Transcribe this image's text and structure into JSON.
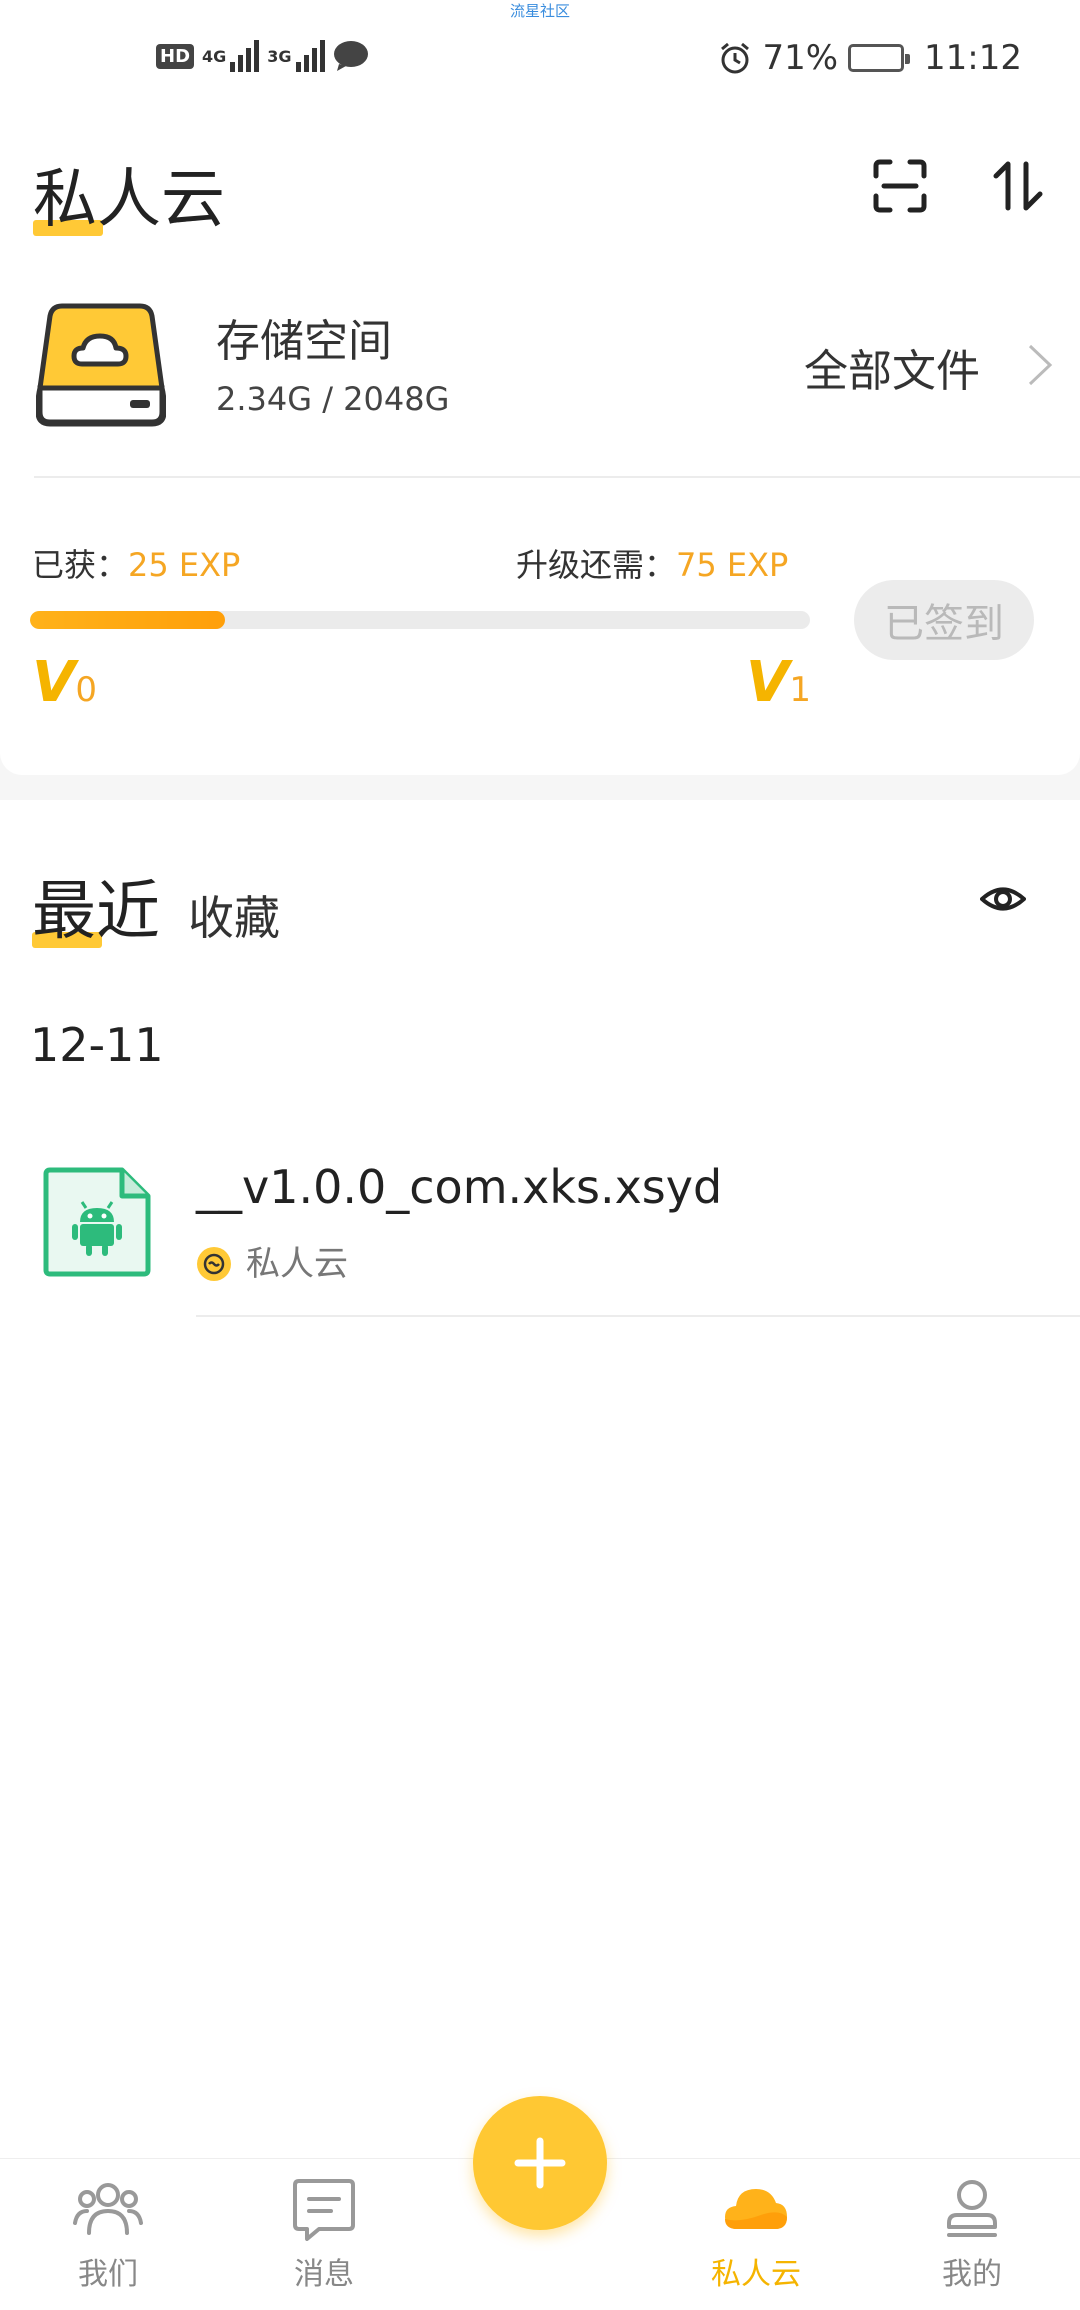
{
  "status_bar": {
    "watermark": "流星社区",
    "hd_label": "HD",
    "sim1_net": "4G",
    "sim2_net": "3G",
    "battery_percent": "71%",
    "battery_level": 0.71,
    "time": "11:12"
  },
  "header": {
    "title": "私人云",
    "scan_icon": "scan-icon",
    "sort_icon": "transfer-sort-icon"
  },
  "storage": {
    "title": "存储空间",
    "usage": "2.34G / 2048G",
    "all_files_label": "全部文件"
  },
  "exp": {
    "got_label": "已获：",
    "got_value": "25 EXP",
    "need_label": "升级还需：",
    "need_value": "75 EXP",
    "progress": 0.25,
    "level_from_letter": "V",
    "level_from_num": "0",
    "level_to_letter": "V",
    "level_to_num": "1",
    "checkin_label": "已签到"
  },
  "recent": {
    "tab_recent": "最近",
    "tab_favorites": "收藏",
    "date": "12-11",
    "files": [
      {
        "name": "__v1.0.0_com.xks.xsyd",
        "source": "私人云",
        "icon": "android-apk-icon"
      }
    ]
  },
  "nav": {
    "items": [
      {
        "label": "我们",
        "icon": "group-icon"
      },
      {
        "label": "消息",
        "icon": "message-icon"
      },
      {
        "label": "私人云",
        "icon": "cloud-icon"
      },
      {
        "label": "我的",
        "icon": "profile-icon"
      }
    ],
    "active": "私人云",
    "fab_icon": "plus-icon"
  },
  "colors": {
    "accent": "#ffc833",
    "accent_text": "#f5a623",
    "android_green": "#2dbb7c"
  }
}
